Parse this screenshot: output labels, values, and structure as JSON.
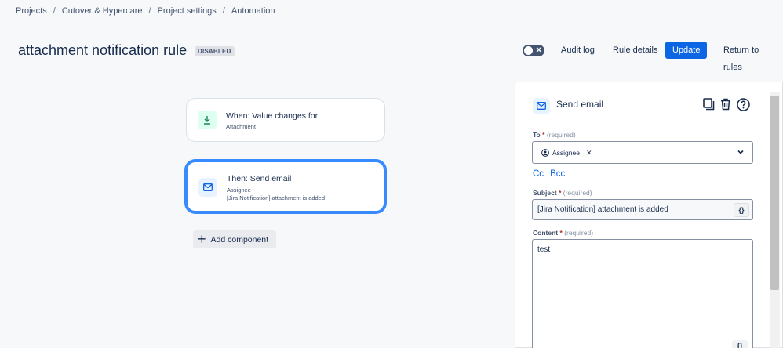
{
  "breadcrumb": [
    "Projects",
    "Cutover & Hypercare",
    "Project settings",
    "Automation"
  ],
  "rule": {
    "title": "attachment notification rule",
    "status_badge": "DISABLED"
  },
  "toolbar": {
    "toggle_state": "off",
    "audit_log": "Audit log",
    "rule_details": "Rule details",
    "update": "Update",
    "return_to_rules": "Return to rules"
  },
  "canvas": {
    "trigger": {
      "title": "When: Value changes for",
      "subtitle": "Attachment",
      "icon": "download-arrow-icon"
    },
    "action": {
      "title": "Then: Send email",
      "subtitle1": "Assignee",
      "subtitle2": "[Jira Notification] attachment is added",
      "icon": "mail-icon"
    },
    "add_component": "Add component"
  },
  "panel": {
    "title": "Send email",
    "to_label": "To",
    "required_mark": "*",
    "required_hint": "(required)",
    "to_chip": "Assignee",
    "cc": "Cc",
    "bcc": "Bcc",
    "subject_label": "Subject",
    "subject_value": "[Jira Notification] attachment is added",
    "content_label": "Content",
    "content_value": "test",
    "brace": "{}"
  },
  "colors": {
    "primary": "#0c66e4",
    "selected_border": "#388bff",
    "trigger_bg": "#dcfff1",
    "action_bg": "#e9f2ff"
  }
}
